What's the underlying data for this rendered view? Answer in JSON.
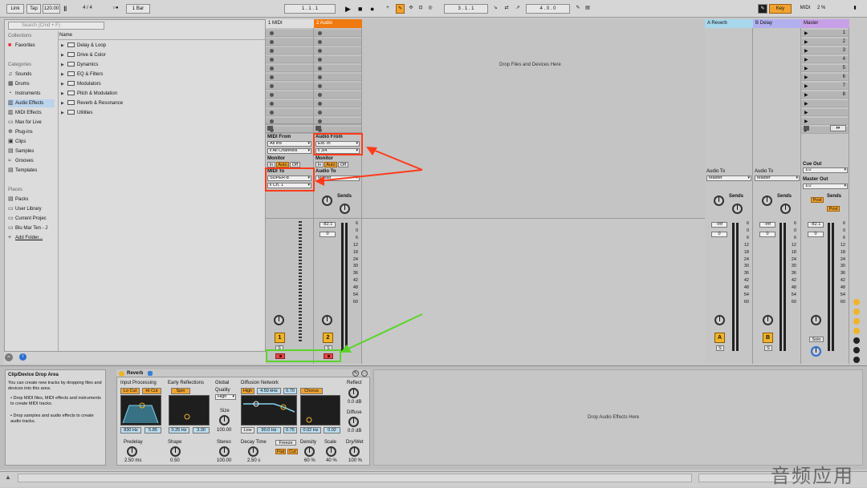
{
  "transport": {
    "link": "Link",
    "tap": "Tap",
    "tempo": "120.00",
    "signature": "4 / 4",
    "metro": "○●",
    "quantize": "1 Bar",
    "position": "1 . 1 . 1",
    "loop_start": "3 . 1 . 1",
    "loop_length": "4 . 0 . 0",
    "key": "Key",
    "midi": "MIDI",
    "cpu": "2 %"
  },
  "browser": {
    "search_placeholder": "Search (Cmd + F)",
    "collections_header": "Collections",
    "favorites": "Favorites",
    "categories_header": "Categories",
    "categories": [
      "Sounds",
      "Drums",
      "Instruments",
      "Audio Effects",
      "MIDI Effects",
      "Max for Live",
      "Plug-ins",
      "Clips",
      "Samples",
      "Grooves",
      "Templates"
    ],
    "places_header": "Places",
    "places": [
      "Packs",
      "User Library",
      "Current Projec",
      "Blu Mar Ten - J",
      "Add Folder..."
    ],
    "name_header": "Name",
    "folders": [
      "Delay & Loop",
      "Drive & Color",
      "Dynamics",
      "EQ & Filters",
      "Modulators",
      "Pitch & Modulation",
      "Reverb & Resonance",
      "Utilities"
    ]
  },
  "tracks": {
    "t1_name": "1 MIDI",
    "t2_name": "2 Audio",
    "drop_files": "Drop Files and Devices Here",
    "midi_from_label": "MIDI From",
    "midi_from_value": "All Ins",
    "midi_from_channel": "All Channels",
    "audio_from_label": "Audio From",
    "audio_from_value": "Ext. In",
    "audio_from_channel": "3/4",
    "monitor_label": "Monitor",
    "monitor_in": "In",
    "monitor_auto": "Auto",
    "monitor_off": "Off",
    "midi_to_label": "MIDI To",
    "midi_to_value": "SUPER-8",
    "midi_to_channel": "Ch. 1",
    "audio_to_label": "Audio To",
    "audio_to_value": "Master",
    "sends_label": "Sends",
    "t2_vol": "-82.1",
    "t2_pan": "0",
    "t1_number": "1",
    "t2_number": "2",
    "solo_short": "S",
    "a_reverb": "A Reverb",
    "b_delay": "B Delay",
    "master": "Master",
    "ret_audio_to_value": "Master",
    "inf": "-Inf",
    "zero": "0",
    "ret_a": "A",
    "ret_b": "B",
    "post": "Post",
    "cue_out_label": "Cue Out",
    "cue_out_value": "1/2",
    "master_out_label": "Master Out",
    "master_out_value": "1/2",
    "master_vol": "-82.1",
    "solo": "Solo",
    "scene_numbers": [
      "1",
      "2",
      "3",
      "4",
      "5",
      "6",
      "7",
      "8"
    ],
    "db_ticks": [
      "6",
      "0",
      "6",
      "12",
      "18",
      "24",
      "30",
      "36",
      "42",
      "48",
      "54",
      "60"
    ]
  },
  "device": {
    "info_title": "Clip/Device Drop Area",
    "info_text": "You can create new tracks by dropping files and devices into this area:",
    "bullet1": "Drop MIDI files, MIDI effects and instruments to create MIDI tracks.",
    "bullet2": "Drop samples and audio effects to create audio tracks.",
    "reverb_title": "Reverb",
    "input_processing": "Input Processing",
    "lo_cut": "Lo Cut",
    "hi_cut": "Hi Cut",
    "freq_830": "830 Hz",
    "val_585": "5.85",
    "early_reflections": "Early Reflections",
    "spin": "Spin",
    "er_rate": "0.25 Hz",
    "er_amt": "3.30",
    "global": "Global",
    "quality": "Quality",
    "quality_value": "High",
    "size": "Size",
    "size_value": "100.00",
    "diffusion_network": "Diffusion Network",
    "high": "High",
    "high_freq": "4.50 kHz",
    "high_amt": "0.70",
    "chorus": "Chorus",
    "low": "Low",
    "low_freq": "90.0 Hz",
    "low_amt": "0.75",
    "chorus_rate": "0.02 Hz",
    "chorus_amt": "0.02",
    "reflect": "Reflect",
    "reflect_value": "0.0 dB",
    "diffuse": "Diffuse",
    "diffuse_value": "0.0 dB",
    "predelay": "Predelay",
    "predelay_value": "2.50 ms",
    "shape": "Shape",
    "shape_value": "0.50",
    "stereo": "Stereo",
    "stereo_value": "100.00",
    "decay_time": "Decay Time",
    "decay_value": "2.50 s",
    "freeze": "Freeze",
    "flat": "Flat",
    "cut": "Cut",
    "density": "Density",
    "density_value": "60 %",
    "scale": "Scale",
    "scale_value": "40 %",
    "drywet": "Dry/Wet",
    "drywet_value": "100 %",
    "drop_audio_effects": "Drop Audio Effects Here"
  },
  "status": {
    "watermark": "音频应用"
  },
  "colors": {
    "accent_orange": "#f0a330",
    "t2_header": "#f07a10",
    "return_a": "#a8d8ec",
    "return_b": "#b3b0f0",
    "master_header": "#c8a0e8",
    "annotation_red": "#ff3b1a",
    "annotation_green": "#5ad42a"
  }
}
